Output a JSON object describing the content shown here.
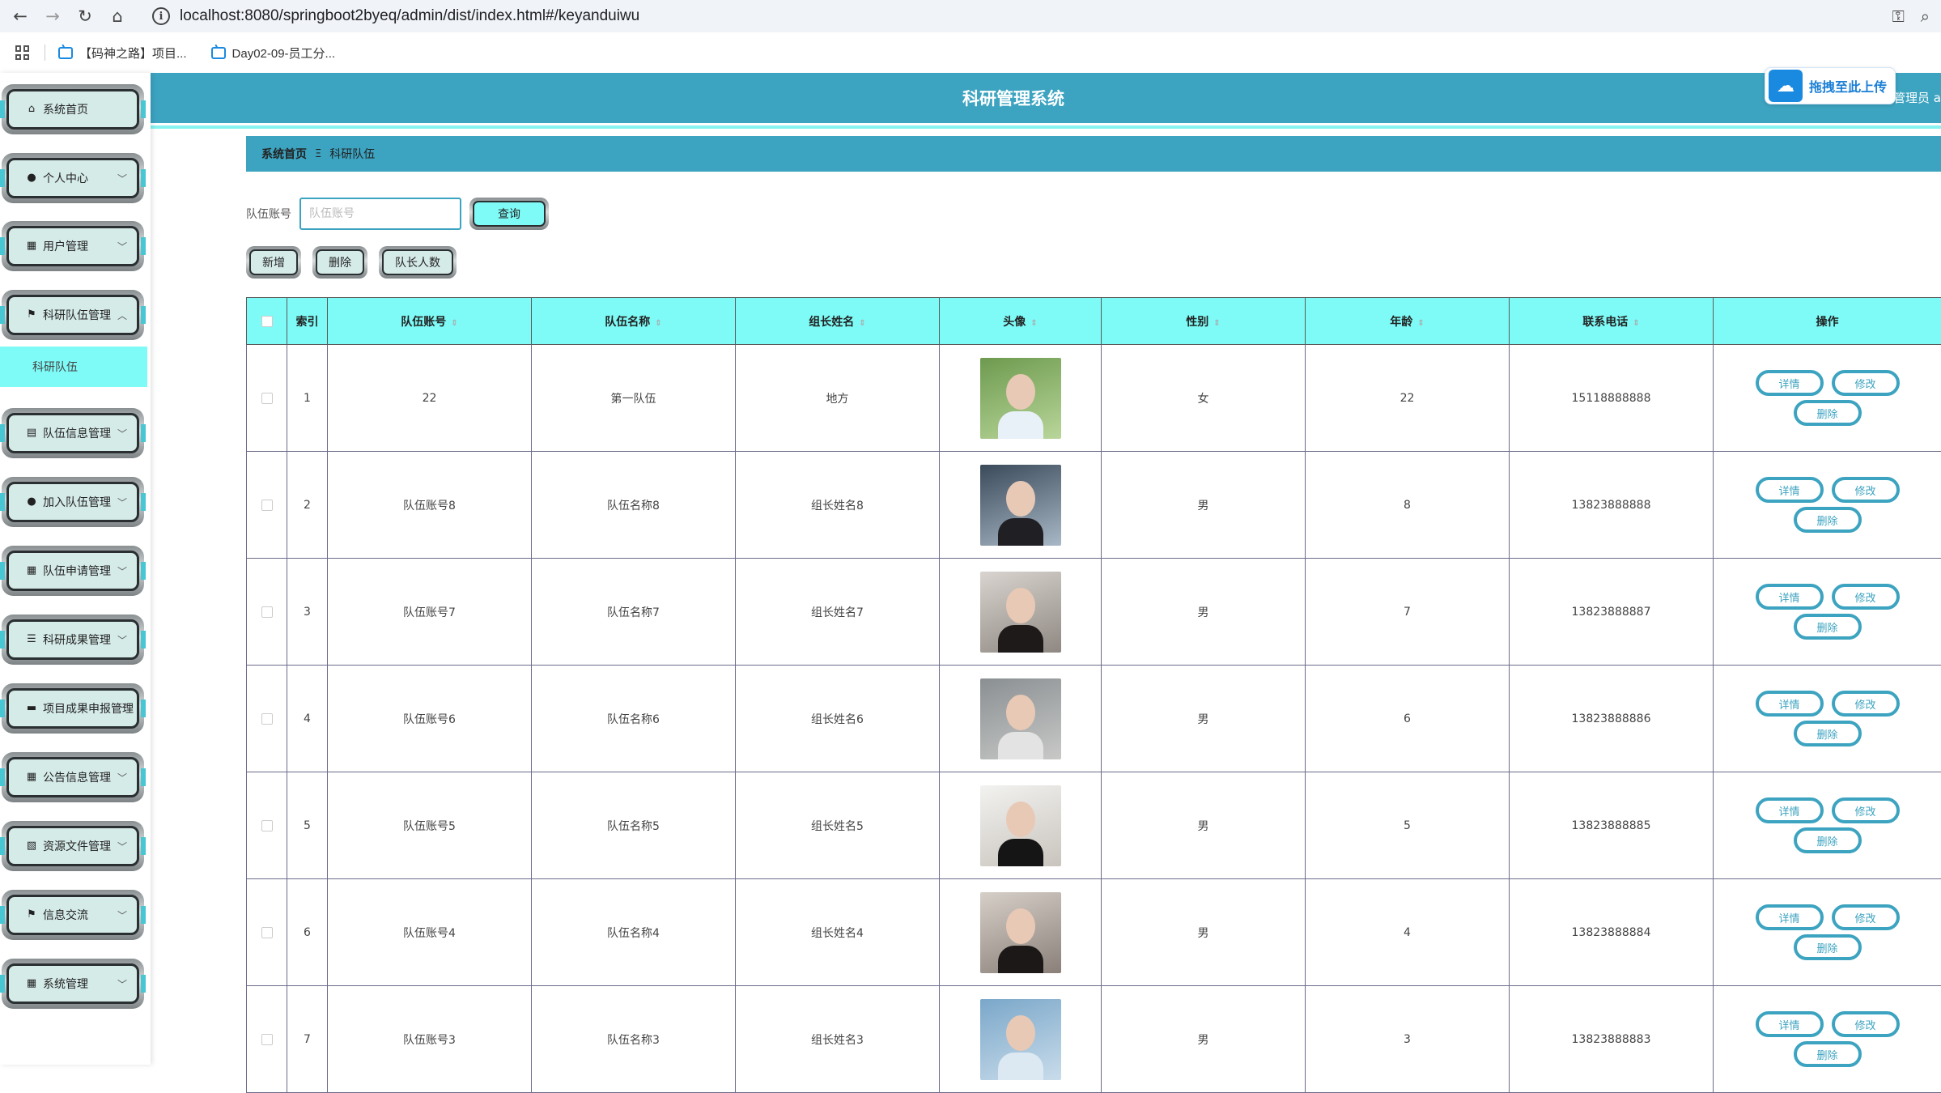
{
  "browser": {
    "url": "localhost:8080/springboot2byeq/admin/dist/index.html#/keyanduiwu",
    "bookmarks": [
      "【码神之路】项目...",
      "Day02-09-员工分..."
    ]
  },
  "header": {
    "title": "科研管理系统",
    "user_role": "管理员 a",
    "upload_label": "拖拽至此上传"
  },
  "sidebar": {
    "items": [
      {
        "label": "系统首页",
        "icon": "home-icon",
        "arrow": false
      },
      {
        "label": "个人中心",
        "icon": "user-icon",
        "arrow": true
      },
      {
        "label": "用户管理",
        "icon": "grid-icon",
        "arrow": true
      },
      {
        "label": "科研队伍管理",
        "icon": "flag-icon",
        "arrow": true,
        "expanded": true
      },
      {
        "label": "队伍信息管理",
        "icon": "clipboard-icon",
        "arrow": true
      },
      {
        "label": "加入队伍管理",
        "icon": "user-icon",
        "arrow": true
      },
      {
        "label": "队伍申请管理",
        "icon": "grid-icon",
        "arrow": true
      },
      {
        "label": "科研成果管理",
        "icon": "list-icon",
        "arrow": true
      },
      {
        "label": "项目成果申报管理",
        "icon": "ticket-icon",
        "arrow": true
      },
      {
        "label": "公告信息管理",
        "icon": "grid-icon",
        "arrow": true
      },
      {
        "label": "资源文件管理",
        "icon": "chart-icon",
        "arrow": true
      },
      {
        "label": "信息交流",
        "icon": "flag-icon",
        "arrow": true
      },
      {
        "label": "系统管理",
        "icon": "grid-icon",
        "arrow": true
      }
    ],
    "submenu": {
      "label": "科研队伍"
    }
  },
  "breadcrumb": {
    "home": "系统首页",
    "separator": "Ξ",
    "current": "科研队伍"
  },
  "search": {
    "label": "队伍账号",
    "placeholder": "队伍账号",
    "value": "",
    "button": "查询"
  },
  "actions": {
    "add": "新增",
    "delete": "删除",
    "captain_count": "队长人数"
  },
  "table": {
    "columns": [
      "",
      "索引",
      "队伍账号",
      "队伍名称",
      "组长姓名",
      "头像",
      "性别",
      "年龄",
      "联系电话",
      "操作"
    ],
    "sortable": [
      false,
      false,
      true,
      true,
      true,
      true,
      true,
      true,
      true,
      false
    ],
    "op_labels": {
      "detail": "详情",
      "edit": "修改",
      "delete": "删除"
    },
    "rows": [
      {
        "index": "1",
        "account": "22",
        "name": "第一队伍",
        "leader": "地方",
        "gender": "女",
        "age": "22",
        "phone": "15118888888",
        "avatar": [
          "#6d9a4e",
          "#b9d69a",
          "#e8f0f8"
        ]
      },
      {
        "index": "2",
        "account": "队伍账号8",
        "name": "队伍名称8",
        "leader": "组长姓名8",
        "gender": "男",
        "age": "8",
        "phone": "13823888888",
        "avatar": [
          "#3a4a5a",
          "#a9b8c6",
          "#1f1f24"
        ]
      },
      {
        "index": "3",
        "account": "队伍账号7",
        "name": "队伍名称7",
        "leader": "组长姓名7",
        "gender": "男",
        "age": "7",
        "phone": "13823888887",
        "avatar": [
          "#d9d4cf",
          "#8f8882",
          "#1d1a19"
        ]
      },
      {
        "index": "4",
        "account": "队伍账号6",
        "name": "队伍名称6",
        "leader": "组长姓名6",
        "gender": "男",
        "age": "6",
        "phone": "13823888886",
        "avatar": [
          "#8a8f92",
          "#c8c9c7",
          "#e3e3e3"
        ]
      },
      {
        "index": "5",
        "account": "队伍账号5",
        "name": "队伍名称5",
        "leader": "组长姓名5",
        "gender": "男",
        "age": "5",
        "phone": "13823888885",
        "avatar": [
          "#f2f2f0",
          "#c9c4bd",
          "#151515"
        ]
      },
      {
        "index": "6",
        "account": "队伍账号4",
        "name": "队伍名称4",
        "leader": "组长姓名4",
        "gender": "男",
        "age": "4",
        "phone": "13823888884",
        "avatar": [
          "#d6cfc8",
          "#8a8079",
          "#1b1817"
        ]
      },
      {
        "index": "7",
        "account": "队伍账号3",
        "name": "队伍名称3",
        "leader": "组长姓名3",
        "gender": "男",
        "age": "3",
        "phone": "13823888883",
        "avatar": [
          "#7aa7c9",
          "#c9dceb",
          "#dce9f2"
        ]
      }
    ]
  }
}
